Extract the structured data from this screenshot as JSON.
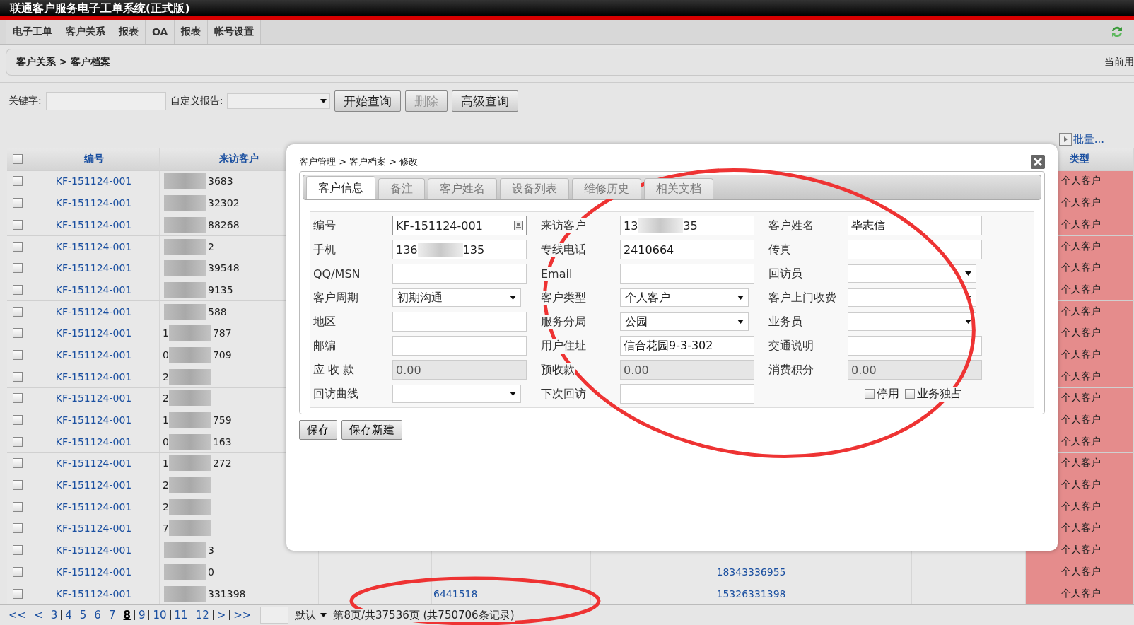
{
  "window": {
    "title": "联通客户服务电子工单系统(正式版)"
  },
  "nav": [
    {
      "label": "电子工单",
      "selected": false
    },
    {
      "label": "客户关系",
      "selected": false
    },
    {
      "label": "报表",
      "selected": false
    },
    {
      "label": "OA",
      "selected": false
    },
    {
      "label": "报表",
      "selected": false
    },
    {
      "label": "帐号设置",
      "selected": false
    }
  ],
  "breadcrumb": "客户关系 > 客户档案",
  "current_user": "当前用",
  "search": {
    "keyword_label": "关键字:",
    "report_label": "自定义报告:",
    "buttons": [
      {
        "label": "开始查询",
        "disabled": false
      },
      {
        "label": "删除",
        "disabled": true
      },
      {
        "label": "高级查询",
        "disabled": false
      }
    ]
  },
  "batch_link": "批量...",
  "table": {
    "select_all": {
      "checked": false
    },
    "columns": [
      "编号",
      "来访客户",
      "类型"
    ],
    "rows": [
      {
        "checked": false,
        "id": "KF-151124-001",
        "visitor_suffix": "3683",
        "type": "个人客户"
      },
      {
        "checked": false,
        "id": "KF-151124-001",
        "visitor_suffix": "32302",
        "type": "个人客户"
      },
      {
        "checked": false,
        "id": "KF-151124-001",
        "visitor_suffix": "88268",
        "type": "个人客户"
      },
      {
        "checked": false,
        "id": "KF-151124-001",
        "visitor_suffix": "2",
        "type": "个人客户"
      },
      {
        "checked": false,
        "id": "KF-151124-001",
        "visitor_suffix": "39548",
        "type": "个人客户"
      },
      {
        "checked": false,
        "id": "KF-151124-001",
        "visitor_suffix": "9135",
        "type": "个人客户"
      },
      {
        "checked": false,
        "id": "KF-151124-001",
        "visitor_suffix": "588",
        "type": "个人客户"
      },
      {
        "checked": false,
        "id": "KF-151124-001",
        "visitor_prefix": "1",
        "visitor_suffix": "787",
        "type": "个人客户"
      },
      {
        "checked": false,
        "id": "KF-151124-001",
        "visitor_prefix": "0",
        "visitor_suffix": "709",
        "type": "个人客户"
      },
      {
        "checked": false,
        "id": "KF-151124-001",
        "visitor_prefix": "2",
        "type": "个人客户"
      },
      {
        "checked": false,
        "id": "KF-151124-001",
        "visitor_prefix": "2",
        "type": "个人客户"
      },
      {
        "checked": false,
        "id": "KF-151124-001",
        "visitor_prefix": "1",
        "visitor_suffix": "759",
        "type": "个人客户"
      },
      {
        "checked": false,
        "id": "KF-151124-001",
        "visitor_prefix": "0",
        "visitor_suffix": "163",
        "type": "个人客户"
      },
      {
        "checked": false,
        "id": "KF-151124-001",
        "visitor_prefix": "1",
        "visitor_suffix": "272",
        "type": "个人客户"
      },
      {
        "checked": false,
        "id": "KF-151124-001",
        "visitor_prefix": "2",
        "type": "个人客户"
      },
      {
        "checked": false,
        "id": "KF-151124-001",
        "visitor_prefix": "2",
        "type": "个人客户"
      },
      {
        "checked": false,
        "id": "KF-151124-001",
        "visitor_prefix": "7",
        "type": "个人客户"
      },
      {
        "checked": false,
        "id": "KF-151124-001",
        "visitor_suffix": "3",
        "type": "个人客户"
      },
      {
        "checked": false,
        "id": "KF-151124-001",
        "visitor_suffix": "0",
        "column_5": "18343336955",
        "type": "个人客户"
      },
      {
        "checked": false,
        "id": "KF-151124-001",
        "visitor_suffix": "331398",
        "column_4": "6441518",
        "column_5": "15326331398",
        "type": "个人客户"
      }
    ]
  },
  "pager": {
    "pages": [
      {
        "label": "<<",
        "selected": false
      },
      {
        "label": "<",
        "selected": false
      },
      {
        "label": "3",
        "selected": false
      },
      {
        "label": "4",
        "selected": false
      },
      {
        "label": "5",
        "selected": false
      },
      {
        "label": "6",
        "selected": false
      },
      {
        "label": "7",
        "selected": false
      },
      {
        "label": "8",
        "selected": true
      },
      {
        "label": "9",
        "selected": false
      },
      {
        "label": "10",
        "selected": false
      },
      {
        "label": "11",
        "selected": false
      },
      {
        "label": "12",
        "selected": false
      },
      {
        "label": ">",
        "selected": false
      },
      {
        "label": ">>",
        "selected": false
      }
    ],
    "sort": "默认",
    "summary": "第8页/共37536页 (共750706条记录)"
  },
  "dialog": {
    "breadcrumb": "客户管理 > 客户档案 > 修改",
    "tabs": [
      {
        "label": "客户信息",
        "selected": true
      },
      {
        "label": "备注",
        "selected": false
      },
      {
        "label": "客户姓名",
        "selected": false
      },
      {
        "label": "设备列表",
        "selected": false
      },
      {
        "label": "维修历史",
        "selected": false
      },
      {
        "label": "相关文档",
        "selected": false
      }
    ],
    "rows": [
      [
        {
          "label": "编号",
          "kind": "lookup",
          "value": "KF-151124-001"
        },
        {
          "label": "来访客户",
          "kind": "masked",
          "prefix": "13",
          "suffix": "35"
        },
        {
          "label": "客户姓名",
          "kind": "text",
          "value": "毕志信"
        }
      ],
      [
        {
          "label": "手机",
          "kind": "masked",
          "prefix": "136",
          "suffix": "135"
        },
        {
          "label": "专线电话",
          "kind": "text",
          "value": "2410664"
        },
        {
          "label": "传真",
          "kind": "text"
        }
      ],
      [
        {
          "label": "QQ/MSN",
          "kind": "text"
        },
        {
          "label": "Email",
          "kind": "text"
        },
        {
          "label": "回访员",
          "kind": "select"
        }
      ],
      [
        {
          "label": "客户周期",
          "kind": "select",
          "value": "初期沟通"
        },
        {
          "label": "客户类型",
          "kind": "select",
          "value": "个人客户"
        },
        {
          "label": "客户上门收费",
          "kind": "select"
        }
      ],
      [
        {
          "label": "地区",
          "kind": "text"
        },
        {
          "label": "服务分局",
          "kind": "select",
          "value": "公园"
        },
        {
          "label": "业务员",
          "kind": "select"
        }
      ],
      [
        {
          "label": "邮编",
          "kind": "text"
        },
        {
          "label": "用户住址",
          "kind": "text",
          "value": "信合花园9-3-302"
        },
        {
          "label": "交通说明",
          "kind": "text"
        }
      ],
      [
        {
          "label": "应 收 款",
          "kind": "readonly",
          "value": "0.00"
        },
        {
          "label": "预收款",
          "kind": "readonly",
          "value": "0.00"
        },
        {
          "label": "消费积分",
          "kind": "readonly",
          "value": "0.00"
        }
      ],
      [
        {
          "label": "回访曲线",
          "kind": "select"
        },
        {
          "label": "下次回访",
          "kind": "text"
        },
        {
          "kind": "checks",
          "items": [
            {
              "label": "停用",
              "checked": false
            },
            {
              "label": "业务独占",
              "checked": false
            }
          ]
        }
      ]
    ],
    "buttons": [
      "保存",
      "保存新建"
    ]
  }
}
